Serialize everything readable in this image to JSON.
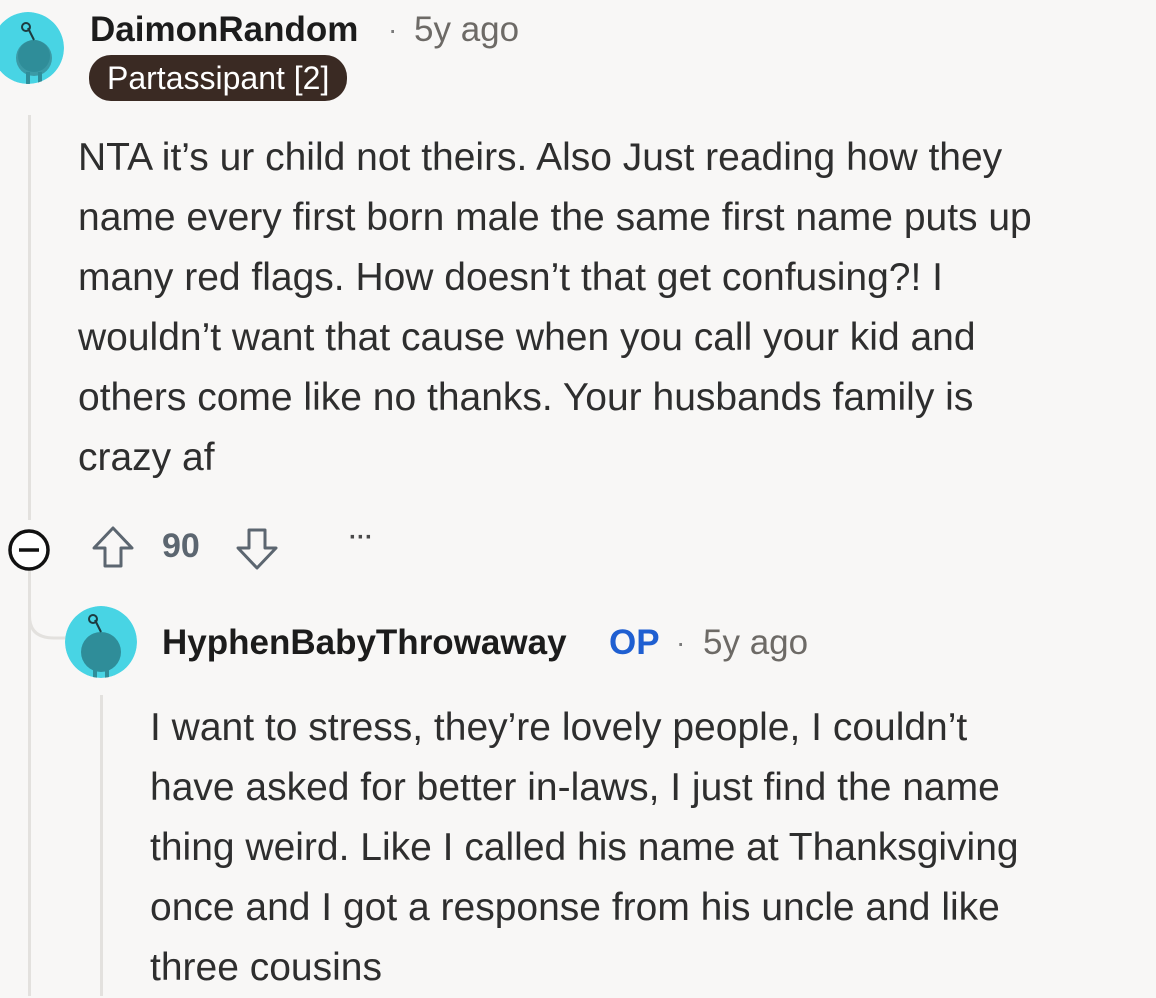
{
  "comment": {
    "username": "DaimonRandom",
    "separator": "·",
    "time": "5y ago",
    "flair": "Partassipant [2]",
    "body_lines": [
      "NTA it’s ur child not theirs. Also Just reading how they",
      "name every first born male the same first name puts up",
      "many red flags. How doesn’t that get confusing?! I",
      "wouldn’t want that cause when you call your kid and",
      "others come like no thanks. Your husbands family is",
      "crazy af"
    ],
    "score": "90",
    "more": "···",
    "icons": {
      "collapse": "collapse-minus-icon",
      "upvote": "upvote-arrow-icon",
      "downvote": "downvote-arrow-icon",
      "more": "more-options-icon"
    }
  },
  "reply": {
    "username": "HyphenBabyThrowaway",
    "op_badge": "OP",
    "separator": "·",
    "time": "5y ago",
    "body_lines": [
      "I want to stress, they’re lovely people, I couldn’t",
      "have asked for better in-laws, I just find the name",
      "thing weird. Like I called his name at Thanksgiving",
      "once and I got a response from his uncle and like",
      "three cousins"
    ]
  },
  "colors": {
    "background": "#f8f7f6",
    "avatar_bg": "#48d4e4",
    "flair_bg": "#3a2a23",
    "op_blue": "#1f5fd1"
  }
}
